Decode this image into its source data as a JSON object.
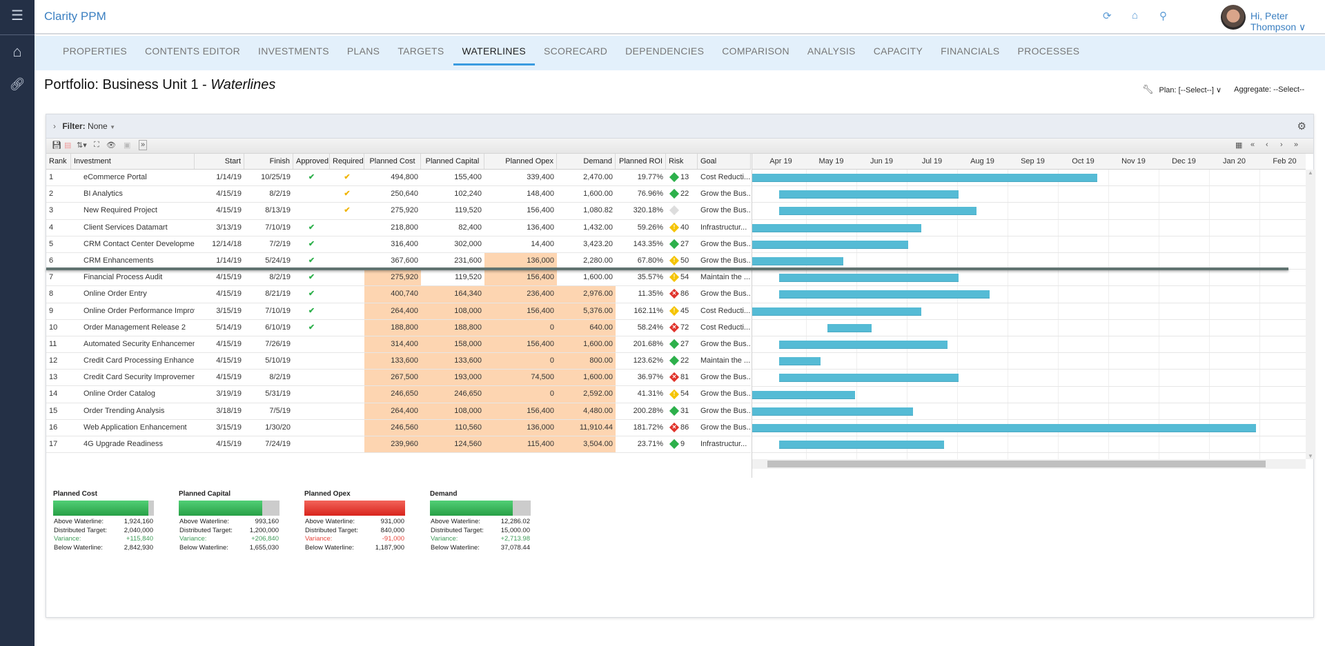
{
  "app": {
    "title": "Clarity PPM",
    "user_greeting": "Hi, Peter Thompson"
  },
  "tabs": [
    {
      "label": "PROPERTIES"
    },
    {
      "label": "CONTENTS EDITOR"
    },
    {
      "label": "INVESTMENTS"
    },
    {
      "label": "PLANS"
    },
    {
      "label": "TARGETS"
    },
    {
      "label": "WATERLINES",
      "active": true
    },
    {
      "label": "SCORECARD"
    },
    {
      "label": "DEPENDENCIES"
    },
    {
      "label": "COMPARISON"
    },
    {
      "label": "ANALYSIS"
    },
    {
      "label": "CAPACITY"
    },
    {
      "label": "FINANCIALS"
    },
    {
      "label": "PROCESSES"
    }
  ],
  "page": {
    "title_prefix": "Portfolio: Business Unit 1 - ",
    "title_italic": "Waterlines",
    "plan_label": "Plan: [--Select--]",
    "aggregate_label": "Aggregate: --Select--"
  },
  "filter": {
    "label": "Filter:",
    "value": "None"
  },
  "columns": {
    "rank": "Rank",
    "investment": "Investment",
    "start": "Start",
    "finish": "Finish",
    "approved": "Approved",
    "required": "Required",
    "cost": "Planned Cost",
    "capital": "Planned Capital",
    "opex": "Planned Opex",
    "demand": "Demand",
    "roi": "Planned ROI",
    "risk": "Risk",
    "goal": "Goal"
  },
  "rows": [
    {
      "rank": "1",
      "investment": "eCommerce Portal",
      "start": "1/14/19",
      "finish": "10/25/19",
      "approved": true,
      "required": true,
      "cost": "494,800",
      "capital": "155,400",
      "opex": "339,400",
      "demand": "2,470.00",
      "roi": "19.77%",
      "risk_level": "low",
      "risk": "13",
      "goal": "Cost Reducti...",
      "highlight": []
    },
    {
      "rank": "2",
      "investment": "BI Analytics",
      "start": "4/15/19",
      "finish": "8/2/19",
      "approved": false,
      "required": true,
      "cost": "250,640",
      "capital": "102,240",
      "opex": "148,400",
      "demand": "1,600.00",
      "roi": "76.96%",
      "risk_level": "low",
      "risk": "22",
      "goal": "Grow the Bus...",
      "highlight": []
    },
    {
      "rank": "3",
      "investment": "New Required Project",
      "start": "4/15/19",
      "finish": "8/13/19",
      "approved": false,
      "required": true,
      "cost": "275,920",
      "capital": "119,520",
      "opex": "156,400",
      "demand": "1,080.82",
      "roi": "320.18%",
      "risk_level": "none",
      "risk": "",
      "goal": "Grow the Bus...",
      "highlight": []
    },
    {
      "rank": "4",
      "investment": "Client Services Datamart",
      "start": "3/13/19",
      "finish": "7/10/19",
      "approved": true,
      "required": false,
      "cost": "218,800",
      "capital": "82,400",
      "opex": "136,400",
      "demand": "1,432.00",
      "roi": "59.26%",
      "risk_level": "medium",
      "risk": "40",
      "goal": "Infrastructur...",
      "highlight": []
    },
    {
      "rank": "5",
      "investment": "CRM Contact Center Development",
      "start": "12/14/18",
      "finish": "7/2/19",
      "approved": true,
      "required": false,
      "cost": "316,400",
      "capital": "302,000",
      "opex": "14,400",
      "demand": "3,423.20",
      "roi": "143.35%",
      "risk_level": "low",
      "risk": "27",
      "goal": "Grow the Bus...",
      "highlight": []
    },
    {
      "rank": "6",
      "investment": "CRM Enhancements",
      "start": "1/14/19",
      "finish": "5/24/19",
      "approved": true,
      "required": false,
      "cost": "367,600",
      "capital": "231,600",
      "opex": "136,000",
      "demand": "2,280.00",
      "roi": "67.80%",
      "risk_level": "medium",
      "risk": "50",
      "goal": "Grow the Bus...",
      "highlight": [
        "opex"
      ]
    },
    {
      "rank": "7",
      "investment": "Financial Process Audit",
      "start": "4/15/19",
      "finish": "8/2/19",
      "approved": true,
      "required": false,
      "cost": "275,920",
      "capital": "119,520",
      "opex": "156,400",
      "demand": "1,600.00",
      "roi": "35.57%",
      "risk_level": "medium",
      "risk": "54",
      "goal": "Maintain the ...",
      "highlight": [
        "cost",
        "opex"
      ]
    },
    {
      "rank": "8",
      "investment": "Online Order Entry",
      "start": "4/15/19",
      "finish": "8/21/19",
      "approved": true,
      "required": false,
      "cost": "400,740",
      "capital": "164,340",
      "opex": "236,400",
      "demand": "2,976.00",
      "roi": "11.35%",
      "risk_level": "high",
      "risk": "86",
      "goal": "Grow the Bus...",
      "highlight": [
        "cost",
        "capital",
        "opex",
        "demand"
      ]
    },
    {
      "rank": "9",
      "investment": "Online Order Performance Improve...",
      "start": "3/15/19",
      "finish": "7/10/19",
      "approved": true,
      "required": false,
      "cost": "264,400",
      "capital": "108,000",
      "opex": "156,400",
      "demand": "5,376.00",
      "roi": "162.11%",
      "risk_level": "medium",
      "risk": "45",
      "goal": "Cost Reducti...",
      "highlight": [
        "cost",
        "capital",
        "opex",
        "demand"
      ]
    },
    {
      "rank": "10",
      "investment": "Order Management Release 2",
      "start": "5/14/19",
      "finish": "6/10/19",
      "approved": true,
      "required": false,
      "cost": "188,800",
      "capital": "188,800",
      "opex": "0",
      "demand": "640.00",
      "roi": "58.24%",
      "risk_level": "high",
      "risk": "72",
      "goal": "Cost Reducti...",
      "highlight": [
        "cost",
        "capital",
        "opex",
        "demand"
      ]
    },
    {
      "rank": "11",
      "investment": "Automated Security Enhancements",
      "start": "4/15/19",
      "finish": "7/26/19",
      "approved": false,
      "required": false,
      "cost": "314,400",
      "capital": "158,000",
      "opex": "156,400",
      "demand": "1,600.00",
      "roi": "201.68%",
      "risk_level": "low",
      "risk": "27",
      "goal": "Grow the Bus...",
      "highlight": [
        "cost",
        "capital",
        "opex",
        "demand"
      ]
    },
    {
      "rank": "12",
      "investment": "Credit Card Processing Enhancement",
      "start": "4/15/19",
      "finish": "5/10/19",
      "approved": false,
      "required": false,
      "cost": "133,600",
      "capital": "133,600",
      "opex": "0",
      "demand": "800.00",
      "roi": "123.62%",
      "risk_level": "low",
      "risk": "22",
      "goal": "Maintain the ...",
      "highlight": [
        "cost",
        "capital",
        "opex",
        "demand"
      ]
    },
    {
      "rank": "13",
      "investment": "Credit Card Security Improvements",
      "start": "4/15/19",
      "finish": "8/2/19",
      "approved": false,
      "required": false,
      "cost": "267,500",
      "capital": "193,000",
      "opex": "74,500",
      "demand": "1,600.00",
      "roi": "36.97%",
      "risk_level": "high",
      "risk": "81",
      "goal": "Grow the Bus...",
      "highlight": [
        "cost",
        "capital",
        "opex",
        "demand"
      ]
    },
    {
      "rank": "14",
      "investment": "Online Order Catalog",
      "start": "3/19/19",
      "finish": "5/31/19",
      "approved": false,
      "required": false,
      "cost": "246,650",
      "capital": "246,650",
      "opex": "0",
      "demand": "2,592.00",
      "roi": "41.31%",
      "risk_level": "medium",
      "risk": "54",
      "goal": "Grow the Bus...",
      "highlight": [
        "cost",
        "capital",
        "opex",
        "demand"
      ]
    },
    {
      "rank": "15",
      "investment": "Order Trending Analysis",
      "start": "3/18/19",
      "finish": "7/5/19",
      "approved": false,
      "required": false,
      "cost": "264,400",
      "capital": "108,000",
      "opex": "156,400",
      "demand": "4,480.00",
      "roi": "200.28%",
      "risk_level": "low",
      "risk": "31",
      "goal": "Grow the Bus...",
      "highlight": [
        "cost",
        "capital",
        "opex",
        "demand"
      ]
    },
    {
      "rank": "16",
      "investment": "Web Application Enhancement",
      "start": "3/15/19",
      "finish": "1/30/20",
      "approved": false,
      "required": false,
      "cost": "246,560",
      "capital": "110,560",
      "opex": "136,000",
      "demand": "11,910.44",
      "roi": "181.72%",
      "risk_level": "high",
      "risk": "86",
      "goal": "Grow the Bus...",
      "highlight": [
        "cost",
        "capital",
        "opex",
        "demand"
      ]
    },
    {
      "rank": "17",
      "investment": "4G Upgrade Readiness",
      "start": "4/15/19",
      "finish": "7/24/19",
      "approved": false,
      "required": false,
      "cost": "239,960",
      "capital": "124,560",
      "opex": "115,400",
      "demand": "3,504.00",
      "roi": "23.71%",
      "risk_level": "low",
      "risk": "9",
      "goal": "Infrastructur...",
      "highlight": [
        "cost",
        "capital",
        "opex",
        "demand"
      ]
    }
  ],
  "waterline_after_rank": 6,
  "gantt": {
    "months": [
      "Apr 19",
      "May 19",
      "Jun 19",
      "Jul 19",
      "Aug 19",
      "Sep 19",
      "Oct 19",
      "Nov 19",
      "Dec 19",
      "Jan 20",
      "Feb 20"
    ]
  },
  "summary": [
    {
      "title": "Planned Cost",
      "above": "1,924,160",
      "target": "2,040,000",
      "variance": "+115,840",
      "below": "2,842,930",
      "fill_pct": 94.3,
      "status": "good"
    },
    {
      "title": "Planned Capital",
      "above": "993,160",
      "target": "1,200,000",
      "variance": "+206,840",
      "below": "1,655,030",
      "fill_pct": 82.8,
      "status": "good"
    },
    {
      "title": "Planned Opex",
      "above": "931,000",
      "target": "840,000",
      "variance": "-91,000",
      "below": "1,187,900",
      "fill_pct": 100,
      "status": "over"
    },
    {
      "title": "Demand",
      "above": "12,286.02",
      "target": "15,000.00",
      "variance": "+2,713.98",
      "below": "37,078.44",
      "fill_pct": 81.9,
      "status": "good"
    }
  ],
  "summary_labels": {
    "above": "Above Waterline:",
    "target": "Distributed Target:",
    "variance": "Variance:",
    "below": "Below Waterline:"
  },
  "colors": {
    "accent": "#3a7fc1",
    "highlight": "#fdd5b1",
    "gantt_bar": "#55bbd5",
    "good": "#2db04b",
    "over": "#e0332b",
    "waterline": "#607370"
  }
}
